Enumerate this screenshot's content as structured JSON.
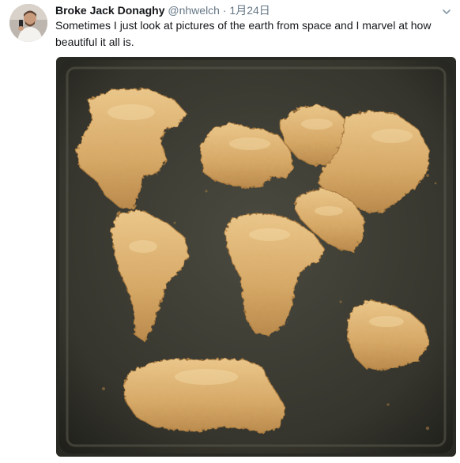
{
  "tweet": {
    "author_name": "Broke Jack Donaghy",
    "handle": "@nhwelch",
    "separator": "·",
    "date": "1月24日",
    "text": "Sometimes I just look at pictures of the earth from space and I marvel at how beautiful it all is."
  },
  "icons": {
    "avatar": "avatar",
    "caret": "chevron-down-icon"
  },
  "colors": {
    "name": "#14171a",
    "meta": "#657786",
    "tray": "#3b3a32",
    "nugget": "#d9ad6c"
  }
}
